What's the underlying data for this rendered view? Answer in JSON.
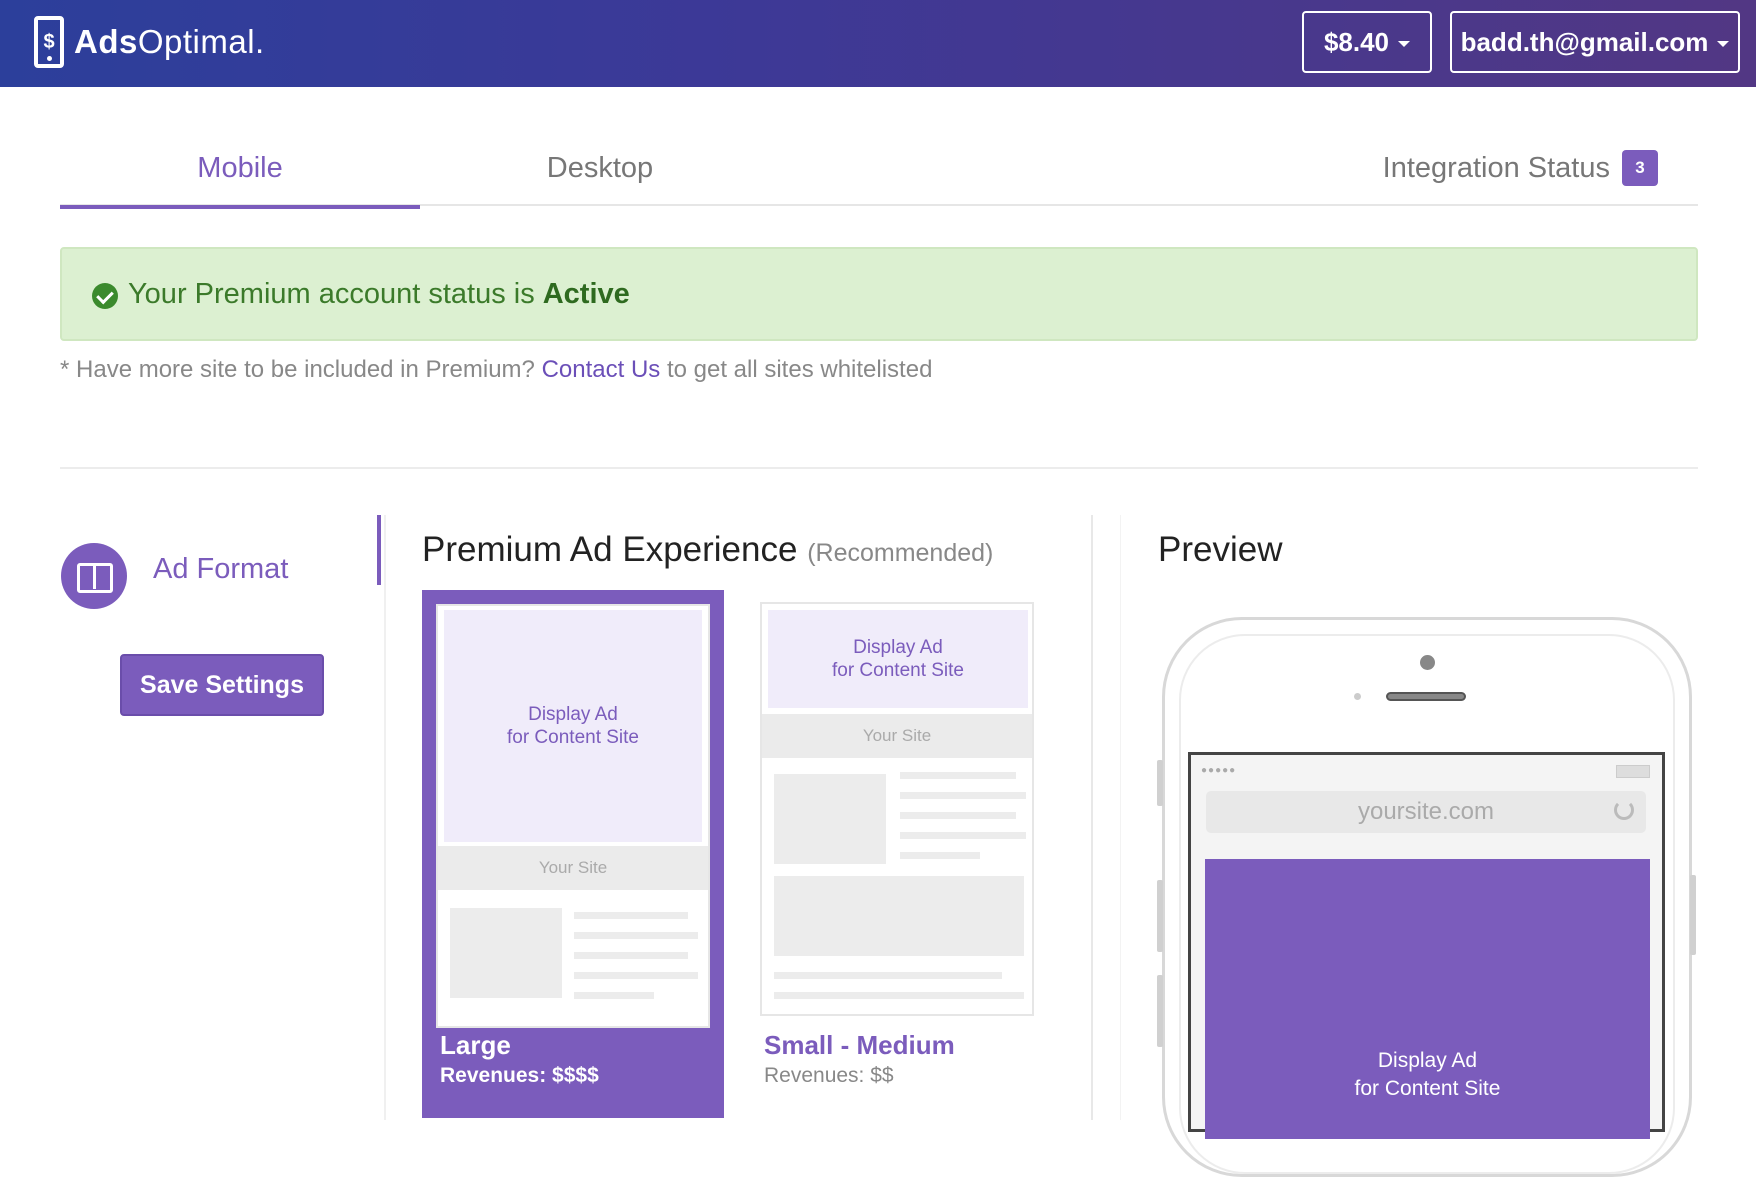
{
  "header": {
    "logo_mark": "$",
    "logo_bold": "Ads",
    "logo_rest": "Optimal.",
    "balance": "$8.40",
    "account_email": "badd.th@gmail.com"
  },
  "tabs": [
    {
      "label": "Mobile",
      "active": true
    },
    {
      "label": "Desktop",
      "active": false
    },
    {
      "label": "Integration Status",
      "badge": "3",
      "active": false
    }
  ],
  "alert": {
    "text": "Your Premium account status is",
    "status": "Active"
  },
  "note": {
    "prefix": "* Have more site to be included in Premium?",
    "link": "Contact Us",
    "suffix": "to get all sites whitelisted"
  },
  "sidebar": {
    "ad_format_label": "Ad Format",
    "save_label": "Save Settings"
  },
  "premium": {
    "title": "Premium Ad Experience",
    "subtitle": "(Recommended)",
    "options": [
      {
        "ad_line1": "Display Ad",
        "ad_line2": "for Content Site",
        "site_label": "Your Site",
        "title": "Large",
        "revenue": "Revenues: $$$$",
        "selected": true
      },
      {
        "ad_line1": "Display Ad",
        "ad_line2": "for Content Site",
        "site_label": "Your Site",
        "title": "Small - Medium",
        "revenue": "Revenues: $$",
        "selected": false
      }
    ]
  },
  "preview": {
    "title": "Preview",
    "status_dots": "●●●●●",
    "url": "yoursite.com",
    "ad_line1": "Display Ad",
    "ad_line2": "for Content Site"
  },
  "colors": {
    "brand": "#7b5cbc",
    "header_gradient_start": "#2c3f9b",
    "header_gradient_end": "#523784",
    "success_bg": "#dcf0d1",
    "success_text": "#3b7a2a"
  }
}
